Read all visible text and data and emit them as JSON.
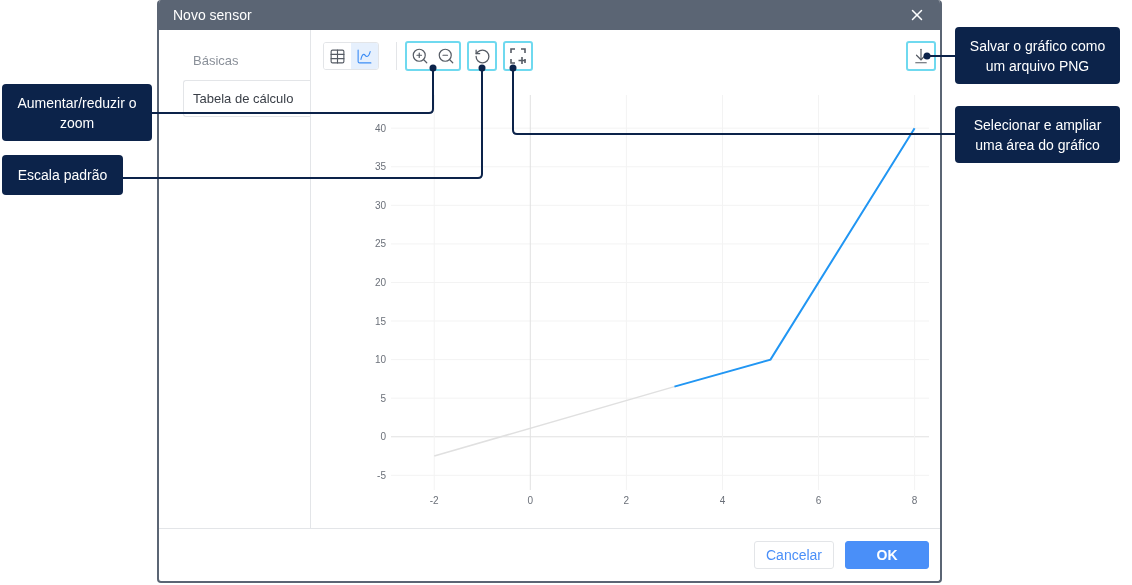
{
  "dialog": {
    "title": "Novo sensor"
  },
  "tabs": [
    {
      "label": "Básicas",
      "selected": false
    },
    {
      "label": "Tabela de cálculo",
      "selected": true
    }
  ],
  "view_toggle": [
    {
      "kind": "table",
      "selected": false
    },
    {
      "kind": "chart",
      "selected": true
    }
  ],
  "chart_data": {
    "type": "line",
    "x": [
      -2,
      3,
      5,
      8
    ],
    "series": [
      {
        "color": "#e0e0e0",
        "values": [
          -2.5,
          6.5,
          null,
          null
        ]
      },
      {
        "color": "#2196f3",
        "values": [
          null,
          6.5,
          10,
          40
        ]
      }
    ],
    "grid": true,
    "xlim": [
      -2.9,
      8.3
    ],
    "ylim": [
      -6.9,
      44.3
    ],
    "xticks": [
      -2,
      0,
      2,
      4,
      6,
      8
    ],
    "yticks": [
      -5,
      0,
      5,
      10,
      15,
      20,
      25,
      30,
      35,
      40
    ]
  },
  "footer_buttons": [
    {
      "kind": "secondary",
      "label": "Cancelar"
    },
    {
      "kind": "primary",
      "label": "OK"
    }
  ],
  "callouts": [
    {
      "text": "Aumentar/reduzir o zoom"
    },
    {
      "text": "Escala padrão"
    },
    {
      "text": "Salvar o gráfico como um arquivo PNG"
    },
    {
      "text": "Selecionar e ampliar uma área do gráfico"
    }
  ]
}
